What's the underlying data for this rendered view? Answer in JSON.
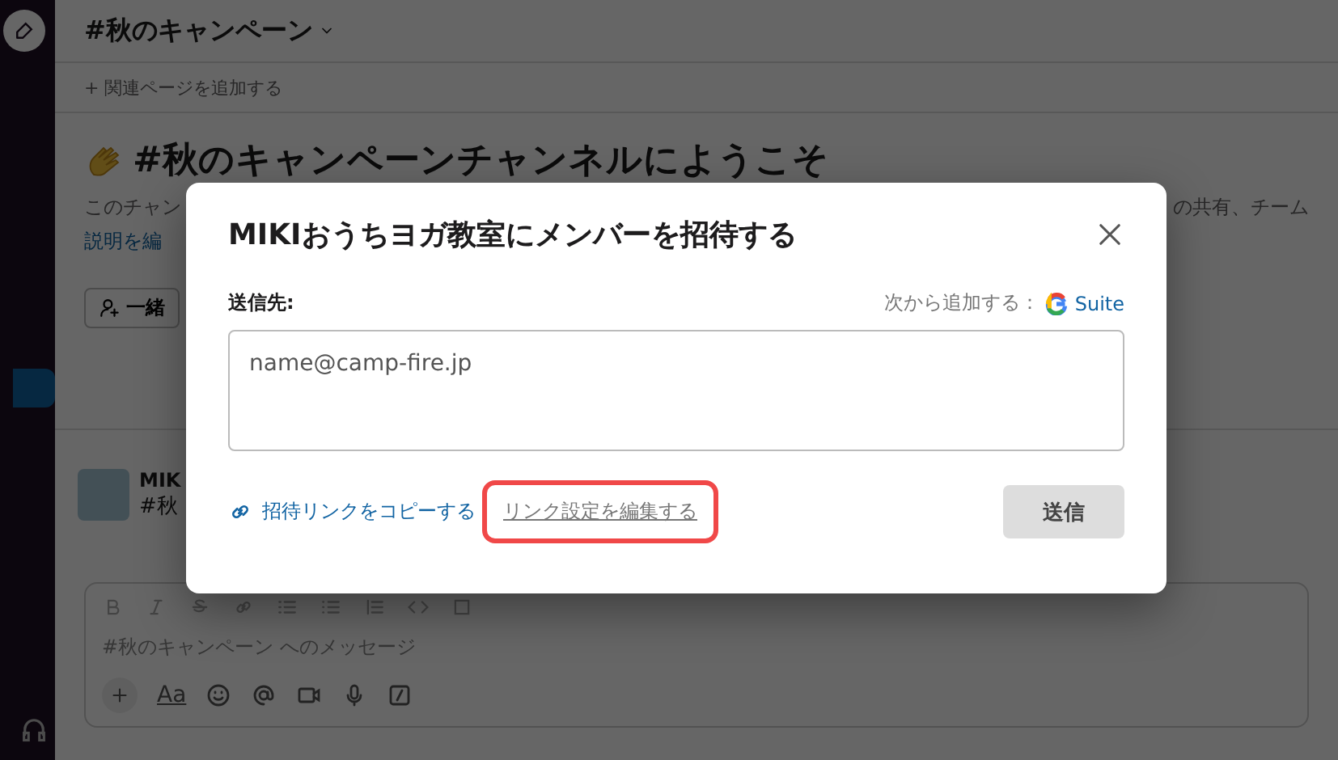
{
  "channel_header": {
    "title": "#秋のキャンペーン",
    "bookmark": "+ 関連ページを追加する"
  },
  "intro": {
    "heading": "#秋のキャンペーンチャンネルにようこそ",
    "description_start": "このチャン",
    "description_end": "の共有、チーム",
    "edit_link": "説明を編",
    "add_button": "一緒"
  },
  "message": {
    "author": "MIK",
    "text": "#秋"
  },
  "composer": {
    "placeholder": "#秋のキャンペーン へのメッセージ",
    "format_button": "Aa"
  },
  "dialog": {
    "title": "MIKIおうちヨガ教室にメンバーを招待する",
    "to_label": "送信先:",
    "add_from": "次から追加する：",
    "gsuite": "Suite",
    "email": {
      "placeholder": "name@camp-fire.jp"
    },
    "copy_link": "招待リンクをコピーする",
    "edit_link": {
      "label": "リンク設定を編集する",
      "highlighted": true
    },
    "send_button": {
      "label": "送信",
      "disabled": true
    }
  }
}
